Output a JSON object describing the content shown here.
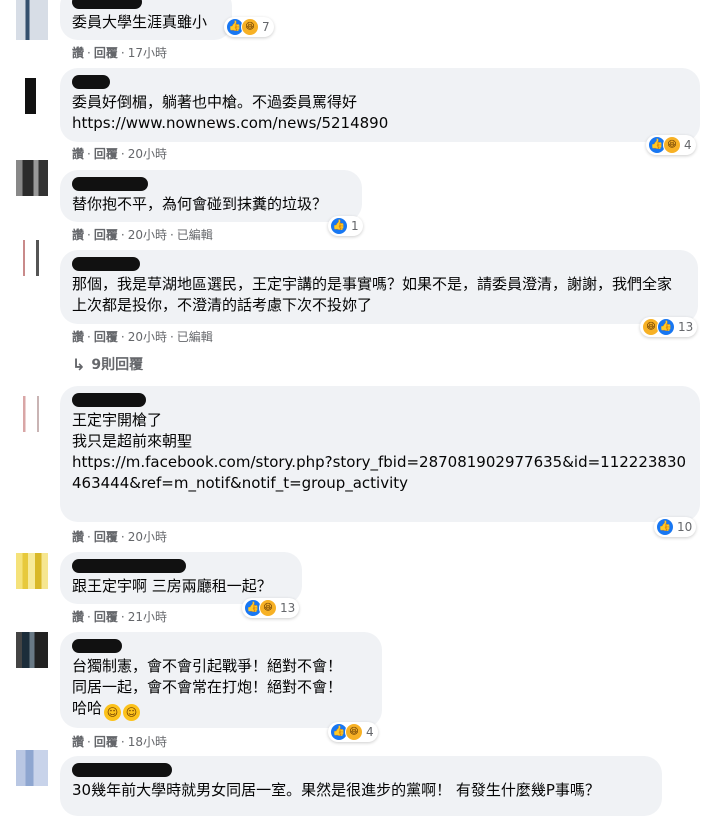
{
  "comments": [
    {
      "text": "委員大學生涯真雖小",
      "actions": [
        "讚",
        "回覆",
        "17小時"
      ],
      "reaction_count": "7",
      "reactions": [
        "like-icon",
        "haha-icon"
      ]
    },
    {
      "text": "委員好倒楣，躺著也中槍。不過委員罵得好",
      "link": "https://www.nownews.com/news/5214890",
      "actions": [
        "讚",
        "回覆",
        "20小時"
      ],
      "reaction_count": "4",
      "reactions": [
        "like-icon",
        "haha-icon"
      ]
    },
    {
      "text": "替你抱不平，為何會碰到抹糞的垃圾？",
      "actions": [
        "讚",
        "回覆",
        "20小時",
        "已編輯"
      ],
      "reaction_count": "1",
      "reactions": [
        "like-icon"
      ]
    },
    {
      "text": "那個，我是草湖地區選民，王定宇講的是事實嗎？如果不是，請委員澄清，謝謝，我們全家上次都是投你，不澄清的話考慮下次不投妳了",
      "actions": [
        "讚",
        "回覆",
        "20小時",
        "已編輯"
      ],
      "reaction_count": "13",
      "reactions": [
        "haha-icon",
        "like-icon"
      ]
    },
    {
      "text": "王定宇開槍了\n我只是超前來朝聖",
      "link": "https://m.facebook.com/story.php?story_fbid=287081902977635&id=112223830463444&ref=m_notif&notif_t=group_activity",
      "actions": [
        "讚",
        "回覆",
        "20小時"
      ],
      "reaction_count": "10",
      "reactions": [
        "like-icon"
      ]
    },
    {
      "text": "跟王定宇啊 三房兩廳租一起？",
      "actions": [
        "讚",
        "回覆",
        "21小時"
      ],
      "reaction_count": "13",
      "reactions": [
        "like-icon",
        "haha-icon"
      ]
    },
    {
      "text": "台獨制憲，會不會引起戰爭！絕對不會！\n同居一起，會不會常在打炮！絕對不會！\n哈哈",
      "actions": [
        "讚",
        "回覆",
        "18小時"
      ],
      "reaction_count": "4",
      "reactions": [
        "like-icon",
        "haha-icon"
      ]
    },
    {
      "text": "30幾年前大學時就男女同居一室。果然是很進步的黨啊！ 有發生什麼幾P事嗎？"
    }
  ],
  "replies_label": "9則回覆",
  "colors": {
    "bubble": "#f0f2f5",
    "meta": "#65676b",
    "like": "#1877f2",
    "haha": "#f7b125"
  }
}
